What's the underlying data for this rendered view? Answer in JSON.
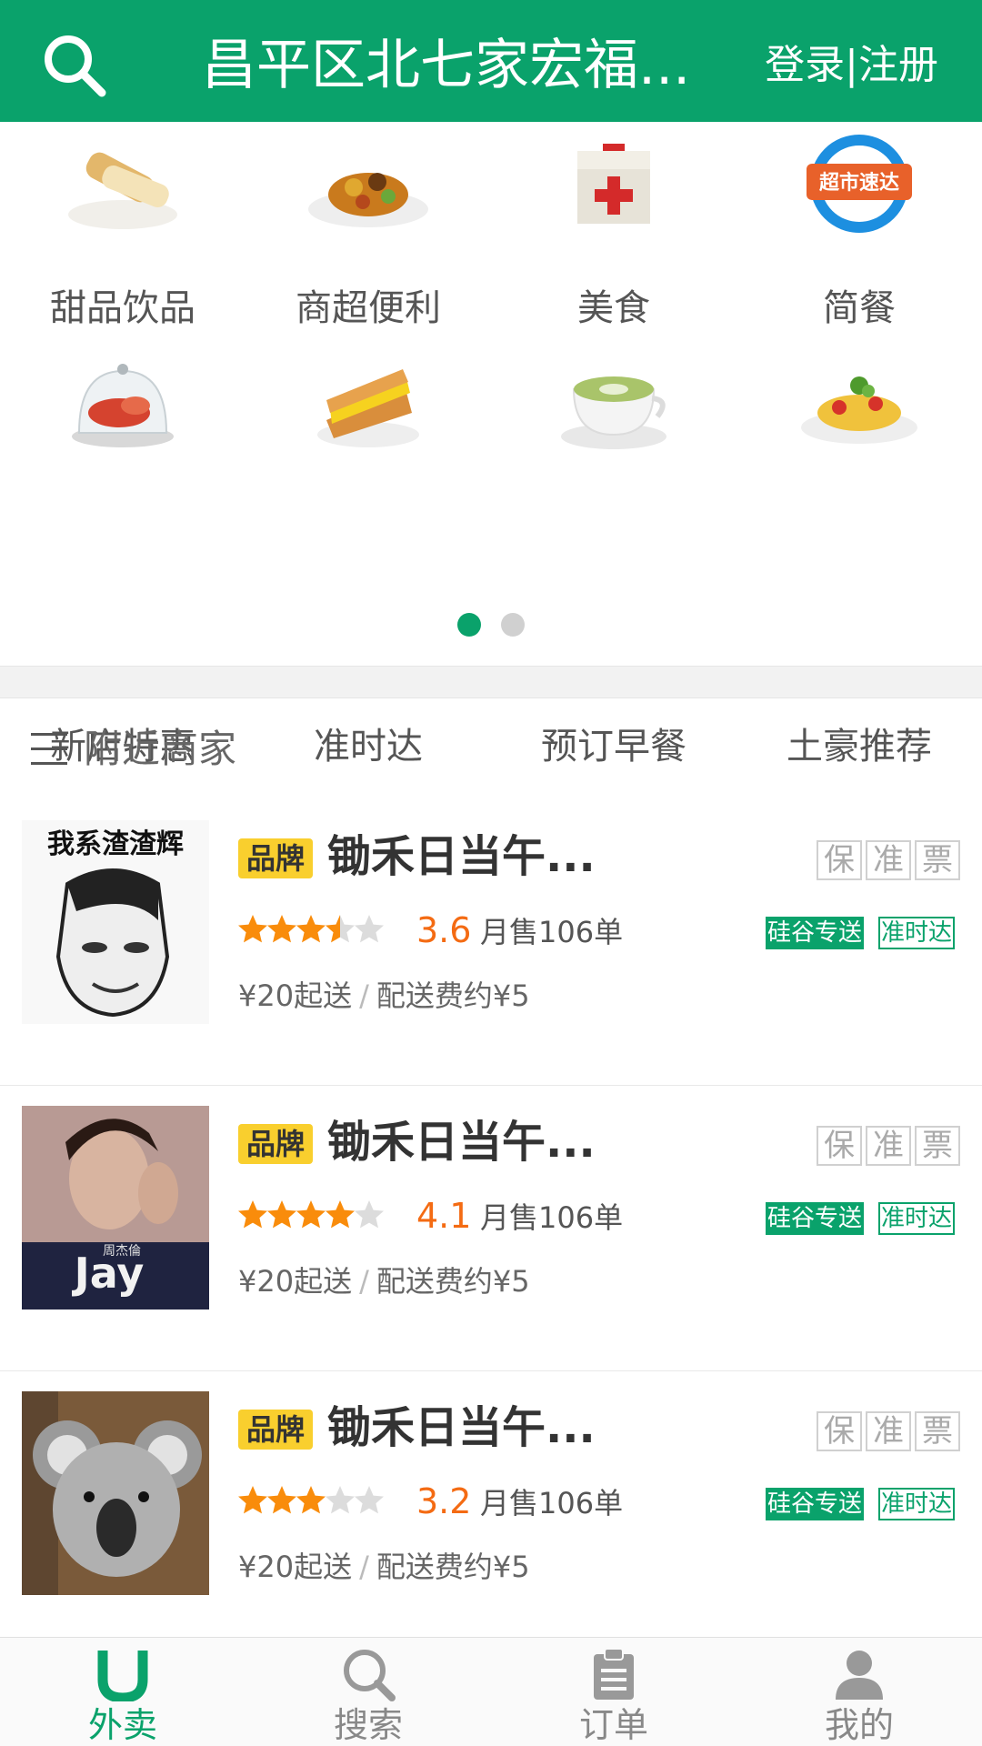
{
  "header": {
    "title": "昌平区北七家宏福...",
    "auth_label": "登录|注册"
  },
  "categories": [
    {
      "label": "甜品饮品",
      "icon": "spring-roll-icon"
    },
    {
      "label": "商超便利",
      "icon": "curry-dish-icon"
    },
    {
      "label": "美食",
      "icon": "first-aid-box-icon"
    },
    {
      "label": "简餐",
      "icon": "supermarket-express-logo",
      "logo_text": "超市速达"
    },
    {
      "label": "新店特惠",
      "icon": "lobster-dome-icon"
    },
    {
      "label": "准时达",
      "icon": "sandwich-icon"
    },
    {
      "label": "预订早餐",
      "icon": "latte-icon"
    },
    {
      "label": "土豪推荐",
      "icon": "pasta-icon"
    }
  ],
  "pager": {
    "count": 2,
    "active": 0
  },
  "nearby": {
    "label": "附近商家"
  },
  "shops": [
    {
      "thumb": "meme-cartoon-image",
      "thumb_text": "我系渣渣辉",
      "brand": "品牌",
      "name": "锄禾日当午...",
      "badges": [
        "保",
        "准",
        "票"
      ],
      "stars": 3.5,
      "rating": "3.6",
      "sales": "月售106单",
      "tag_fill": "硅谷专送",
      "tag_line": "准时达",
      "min_order": "¥20起送",
      "separator": "/",
      "delivery_fee": "配送费约¥5"
    },
    {
      "thumb": "jay-album-cover-image",
      "thumb_text": "Jay",
      "thumb_subtext": "周杰倫",
      "brand": "品牌",
      "name": "锄禾日当午...",
      "badges": [
        "保",
        "准",
        "票"
      ],
      "stars": 4,
      "rating": "4.1",
      "sales": "月售106单",
      "tag_fill": "硅谷专送",
      "tag_line": "准时达",
      "min_order": "¥20起送",
      "separator": "/",
      "delivery_fee": "配送费约¥5"
    },
    {
      "thumb": "koala-photo-image",
      "brand": "品牌",
      "name": "锄禾日当午...",
      "badges": [
        "保",
        "准",
        "票"
      ],
      "stars": 3,
      "rating": "3.2",
      "sales": "月售106单",
      "tag_fill": "硅谷专送",
      "tag_line": "准时达",
      "min_order": "¥20起送",
      "separator": "/",
      "delivery_fee": "配送费约¥5"
    }
  ],
  "tabs": [
    {
      "label": "外卖",
      "icon": "takeout-u-icon",
      "active": true
    },
    {
      "label": "搜索",
      "icon": "search-icon",
      "active": false
    },
    {
      "label": "订单",
      "icon": "clipboard-icon",
      "active": false
    },
    {
      "label": "我的",
      "icon": "user-icon",
      "active": false
    }
  ],
  "colors": {
    "brand_green": "#0aa26b",
    "rating_orange": "#f46b13",
    "star_orange": "#f98c0b",
    "brand_yellow": "#f9cf2e"
  }
}
